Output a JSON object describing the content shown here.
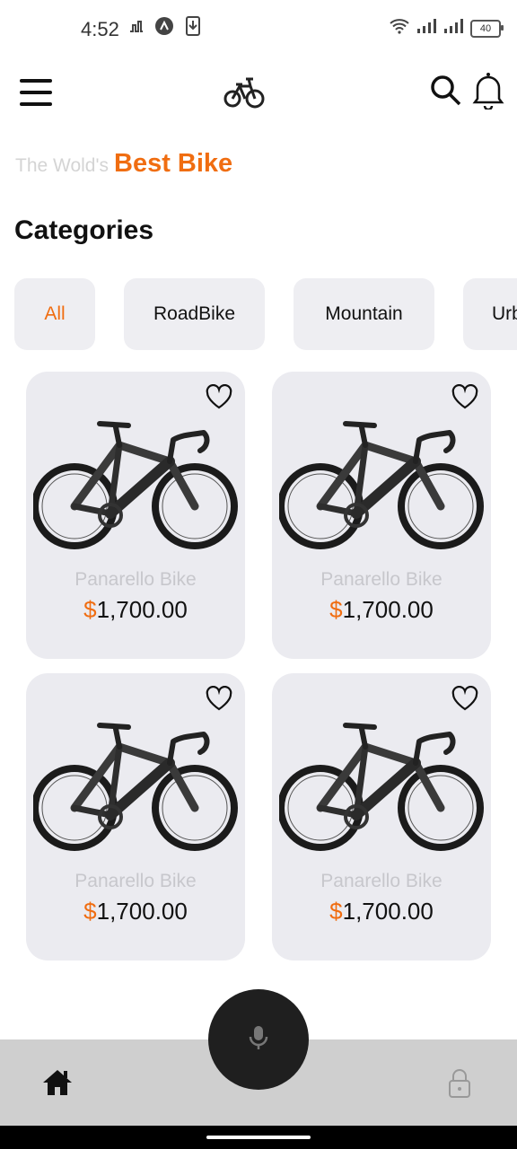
{
  "status": {
    "time": "4:52",
    "battery": "40",
    "left_icons": [
      "music-notification-icon",
      "app-notification-icon",
      "download-icon"
    ],
    "right_icons": [
      "wifi-icon",
      "signal-icon",
      "signal-icon",
      "battery-icon"
    ]
  },
  "header": {
    "icons": [
      "menu-icon",
      "bicycle-logo-icon",
      "search-icon",
      "bell-icon"
    ]
  },
  "tagline": {
    "prefix": "The Wold's",
    "highlight": "Best Bike"
  },
  "categories": {
    "title": "Categories",
    "items": [
      {
        "label": "All",
        "active": true
      },
      {
        "label": "RoadBike",
        "active": false
      },
      {
        "label": "Mountain",
        "active": false
      },
      {
        "label": "Urban",
        "active": false
      }
    ]
  },
  "products": [
    {
      "name": "Panarello Bike",
      "currency": "$",
      "price": "1,700.00"
    },
    {
      "name": "Panarello Bike",
      "currency": "$",
      "price": "1,700.00"
    },
    {
      "name": "Panarello Bike",
      "currency": "$",
      "price": "1,700.00"
    },
    {
      "name": "Panarello Bike",
      "currency": "$",
      "price": "1,700.00"
    }
  ],
  "bottom_nav": {
    "icons": [
      "home-icon",
      "microphone-icon",
      "lock-icon"
    ]
  },
  "colors": {
    "accent": "#f06d11",
    "card_bg": "#ebebf0",
    "nav_bg": "#cfcfcf",
    "fab_bg": "#1f1f1f"
  }
}
